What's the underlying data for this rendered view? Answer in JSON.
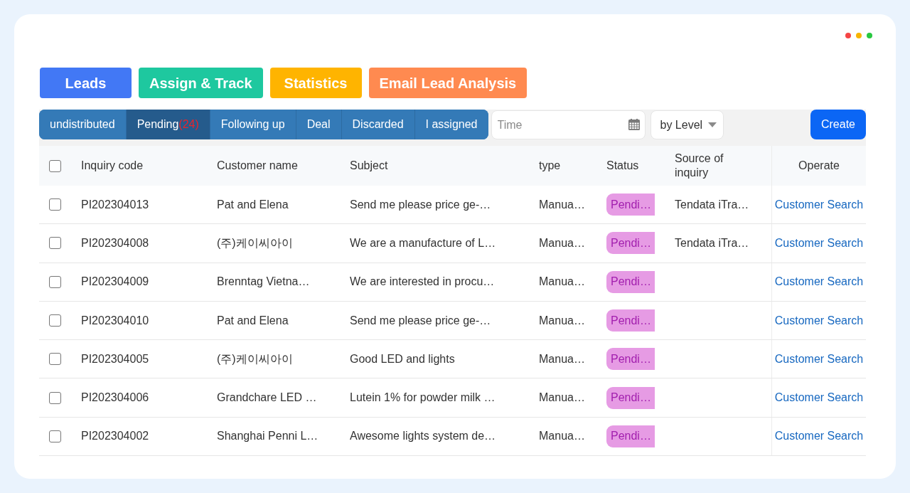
{
  "window_dots": [
    {
      "color": "#f54545"
    },
    {
      "color": "#f8b400"
    },
    {
      "color": "#28c840"
    }
  ],
  "modules": [
    {
      "label": "Leads",
      "color": "#4278f5"
    },
    {
      "label": "Assign & Track",
      "color": "#1ec89f"
    },
    {
      "label": "Statistics",
      "color": "#ffb400"
    },
    {
      "label": "Email Lead Analysis",
      "color": "#ff8a50"
    }
  ],
  "tabs": [
    {
      "label": "undistributed",
      "selected": false
    },
    {
      "label": "Pending",
      "count": "(24)",
      "selected": true
    },
    {
      "label": "Following up",
      "selected": false
    },
    {
      "label": "Deal",
      "selected": false
    },
    {
      "label": "Discarded",
      "selected": false
    },
    {
      "label": "I assigned",
      "selected": false
    }
  ],
  "filters": {
    "time": {
      "placeholder": "Time"
    },
    "level": {
      "value": "by Level"
    }
  },
  "create_button": "Create",
  "table": {
    "select_all_checked": false,
    "columns": [
      "Inquiry code",
      "Customer name",
      "Subject",
      "type",
      "Status",
      "Source of inquiry",
      "Operate"
    ],
    "rows": [
      {
        "checked": false,
        "inquiry_code": "PI202304013",
        "customer_name": "Pat and Elena",
        "subject": "Send me please price ge-…",
        "type": "Manua…",
        "status": "Pendi…",
        "source": "Tendata iTra…",
        "operate": "Customer Search"
      },
      {
        "checked": false,
        "inquiry_code": "PI202304008",
        "customer_name": "(주)케이씨아이",
        "subject": "We are a manufacture of L…",
        "type": "Manua…",
        "status": "Pendi…",
        "source": "Tendata iTra…",
        "operate": "Customer Search"
      },
      {
        "checked": false,
        "inquiry_code": "PI202304009",
        "customer_name": "Brenntag Vietna…",
        "subject": "We are interested in procu…",
        "type": "Manua…",
        "status": "Pendi…",
        "operate": "Customer Search"
      },
      {
        "checked": false,
        "inquiry_code": "PI202304010",
        "customer_name": "Pat and Elena",
        "subject": "Send me please price ge-…",
        "type": "Manua…",
        "status": "Pendi…",
        "operate": "Customer Search"
      },
      {
        "checked": false,
        "inquiry_code": "PI202304005",
        "customer_name": "(주)케이씨아이",
        "subject": "Good LED and lights",
        "type": "Manua…",
        "status": "Pendi…",
        "operate": "Customer Search"
      },
      {
        "checked": false,
        "inquiry_code": "PI202304006",
        "customer_name": "Grandchare LED …",
        "subject": "Lutein 1% for powder milk …",
        "type": "Manua…",
        "status": "Pendi…",
        "operate": "Customer Search"
      },
      {
        "checked": false,
        "inquiry_code": "PI202304002",
        "customer_name": "Shanghai Penni L…",
        "subject": "Awesome lights system de…",
        "type": "Manua…",
        "status": "Pendi…",
        "operate": "Customer Search"
      }
    ]
  }
}
